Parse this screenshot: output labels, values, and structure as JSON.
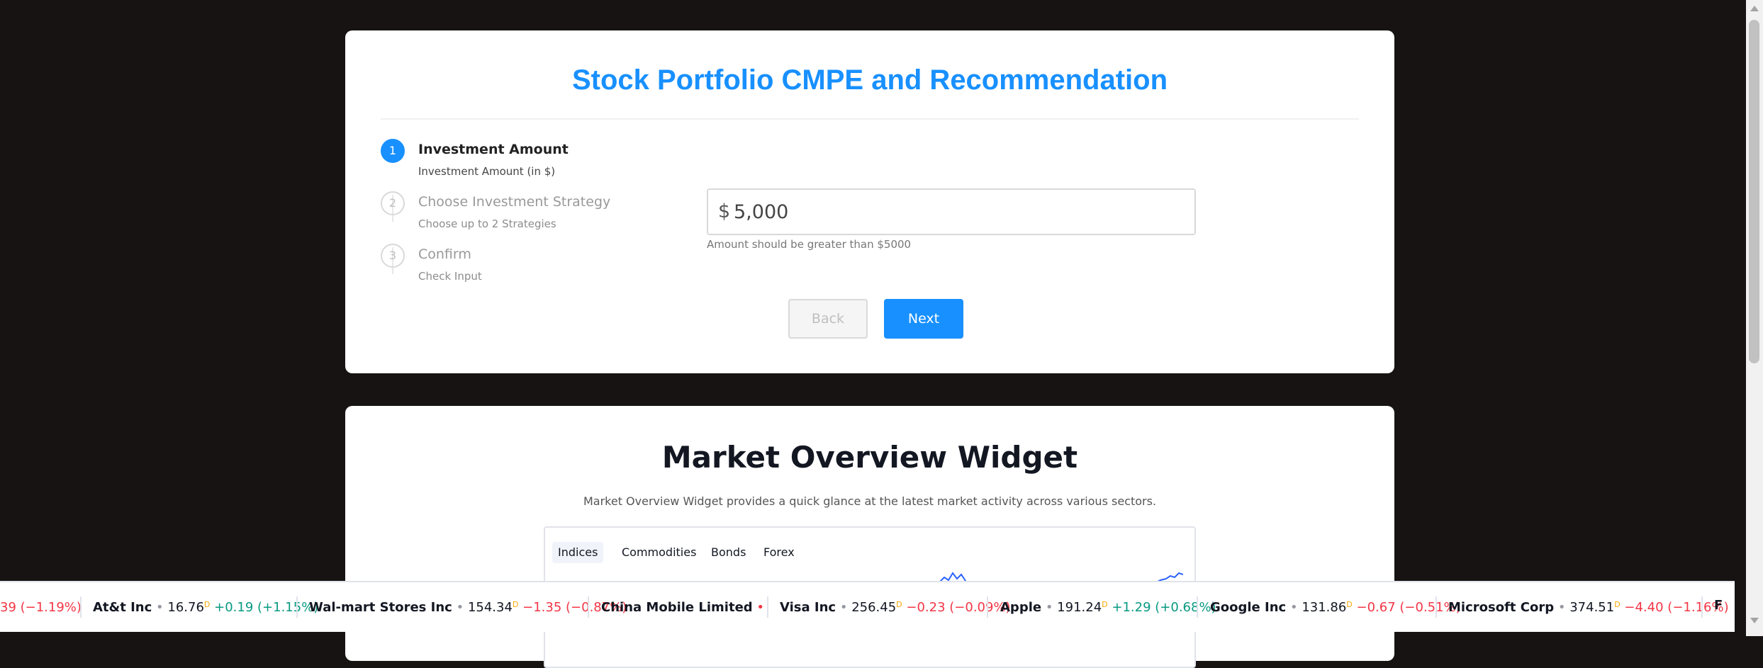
{
  "form": {
    "title": "Stock Portfolio CMPE and Recommendation",
    "steps": [
      {
        "number": "1",
        "label": "Investment Amount",
        "description": "Investment Amount (in $)",
        "state": "active"
      },
      {
        "number": "2",
        "label": "Choose Investment Strategy",
        "description": "Choose up to 2 Strategies",
        "state": "pending"
      },
      {
        "number": "3",
        "label": "Confirm",
        "description": "Check Input",
        "state": "pending"
      }
    ],
    "amount": {
      "currency_symbol": "$",
      "value": "5,000",
      "hint": "Amount should be greater than $5000"
    },
    "back_label": "Back",
    "next_label": "Next"
  },
  "market": {
    "title": "Market Overview Widget",
    "description": "Market Overview Widget provides a quick glance at the latest market activity across various sectors.",
    "tabs": [
      "Indices",
      "Commodities",
      "Bonds",
      "Forex"
    ],
    "active_tab": "Indices"
  },
  "ticker": {
    "items": [
      {
        "name": "",
        "price": "",
        "change": "39 (−1.19%)",
        "direction": "down"
      },
      {
        "name": "At&t Inc",
        "price": "16.76",
        "change": "+0.19 (+1.15%)",
        "direction": "up"
      },
      {
        "name": "Wal-mart Stores Inc",
        "price": "154.34",
        "change": "−1.35 (−0.87%)",
        "direction": "down"
      },
      {
        "name": "China Mobile Limited",
        "price": "",
        "change": "",
        "direction": "none"
      },
      {
        "name": "Visa Inc",
        "price": "256.45",
        "change": "−0.23 (−0.09%)",
        "direction": "down"
      },
      {
        "name": "Apple",
        "price": "191.24",
        "change": "+1.29 (+0.68%)",
        "direction": "up"
      },
      {
        "name": "Google Inc",
        "price": "131.86",
        "change": "−0.67 (−0.51%)",
        "direction": "down"
      },
      {
        "name": "Microsoft Corp",
        "price": "374.51",
        "change": "−4.40 (−1.16%)",
        "direction": "down"
      }
    ],
    "currency_mark": "D",
    "bullet": "•",
    "logo_text": "F",
    "brand_icon": "tradingview-logo-icon"
  },
  "colors": {
    "page_bg": "#171312",
    "accent": "#1890ff",
    "up": "#089981",
    "down": "#f23645"
  }
}
